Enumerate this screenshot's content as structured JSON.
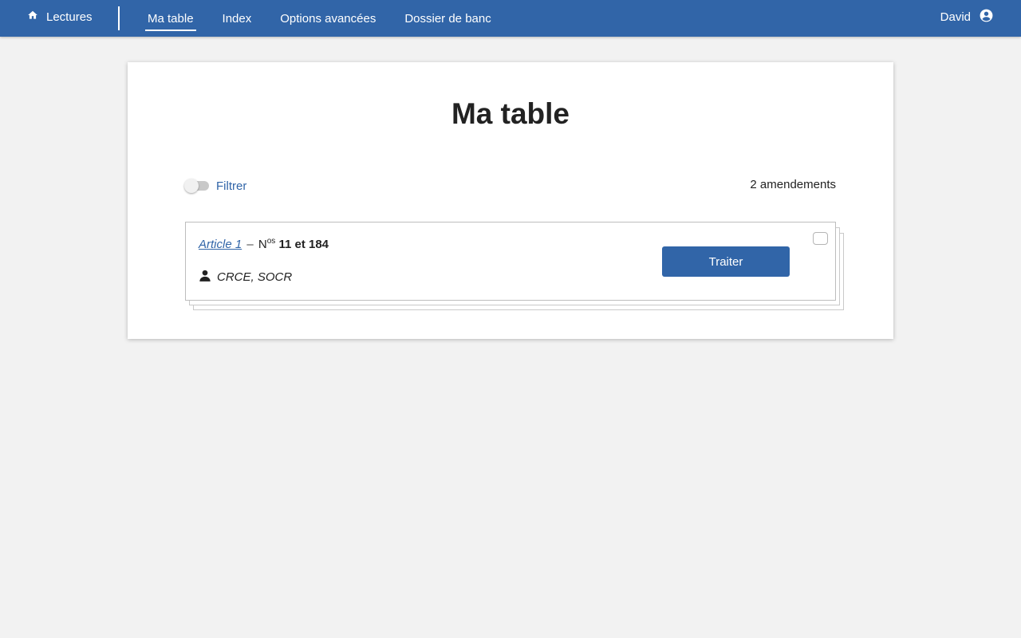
{
  "topbar": {
    "home_label": "Lectures",
    "tabs": [
      {
        "label": "Ma table",
        "active": true
      },
      {
        "label": "Index",
        "active": false
      },
      {
        "label": "Options avancées",
        "active": false
      },
      {
        "label": "Dossier de banc",
        "active": false
      }
    ],
    "user_name": "David",
    "home_icon": "home-icon",
    "user_icon": "account-circle-icon",
    "background_color": "#3165a8"
  },
  "main": {
    "title": "Ma table",
    "filter_label": "Filtrer",
    "filter_enabled": false,
    "count_label": "2 amendements"
  },
  "amendements": [
    {
      "article_label": "Article 1",
      "separator": "–",
      "num_prefix": "N",
      "num_suffix": "os",
      "numbers": "11 et 184",
      "authors": "CRCE, SOCR",
      "author_icon": "person-icon",
      "action_label": "Traiter",
      "checked": false
    }
  ]
}
